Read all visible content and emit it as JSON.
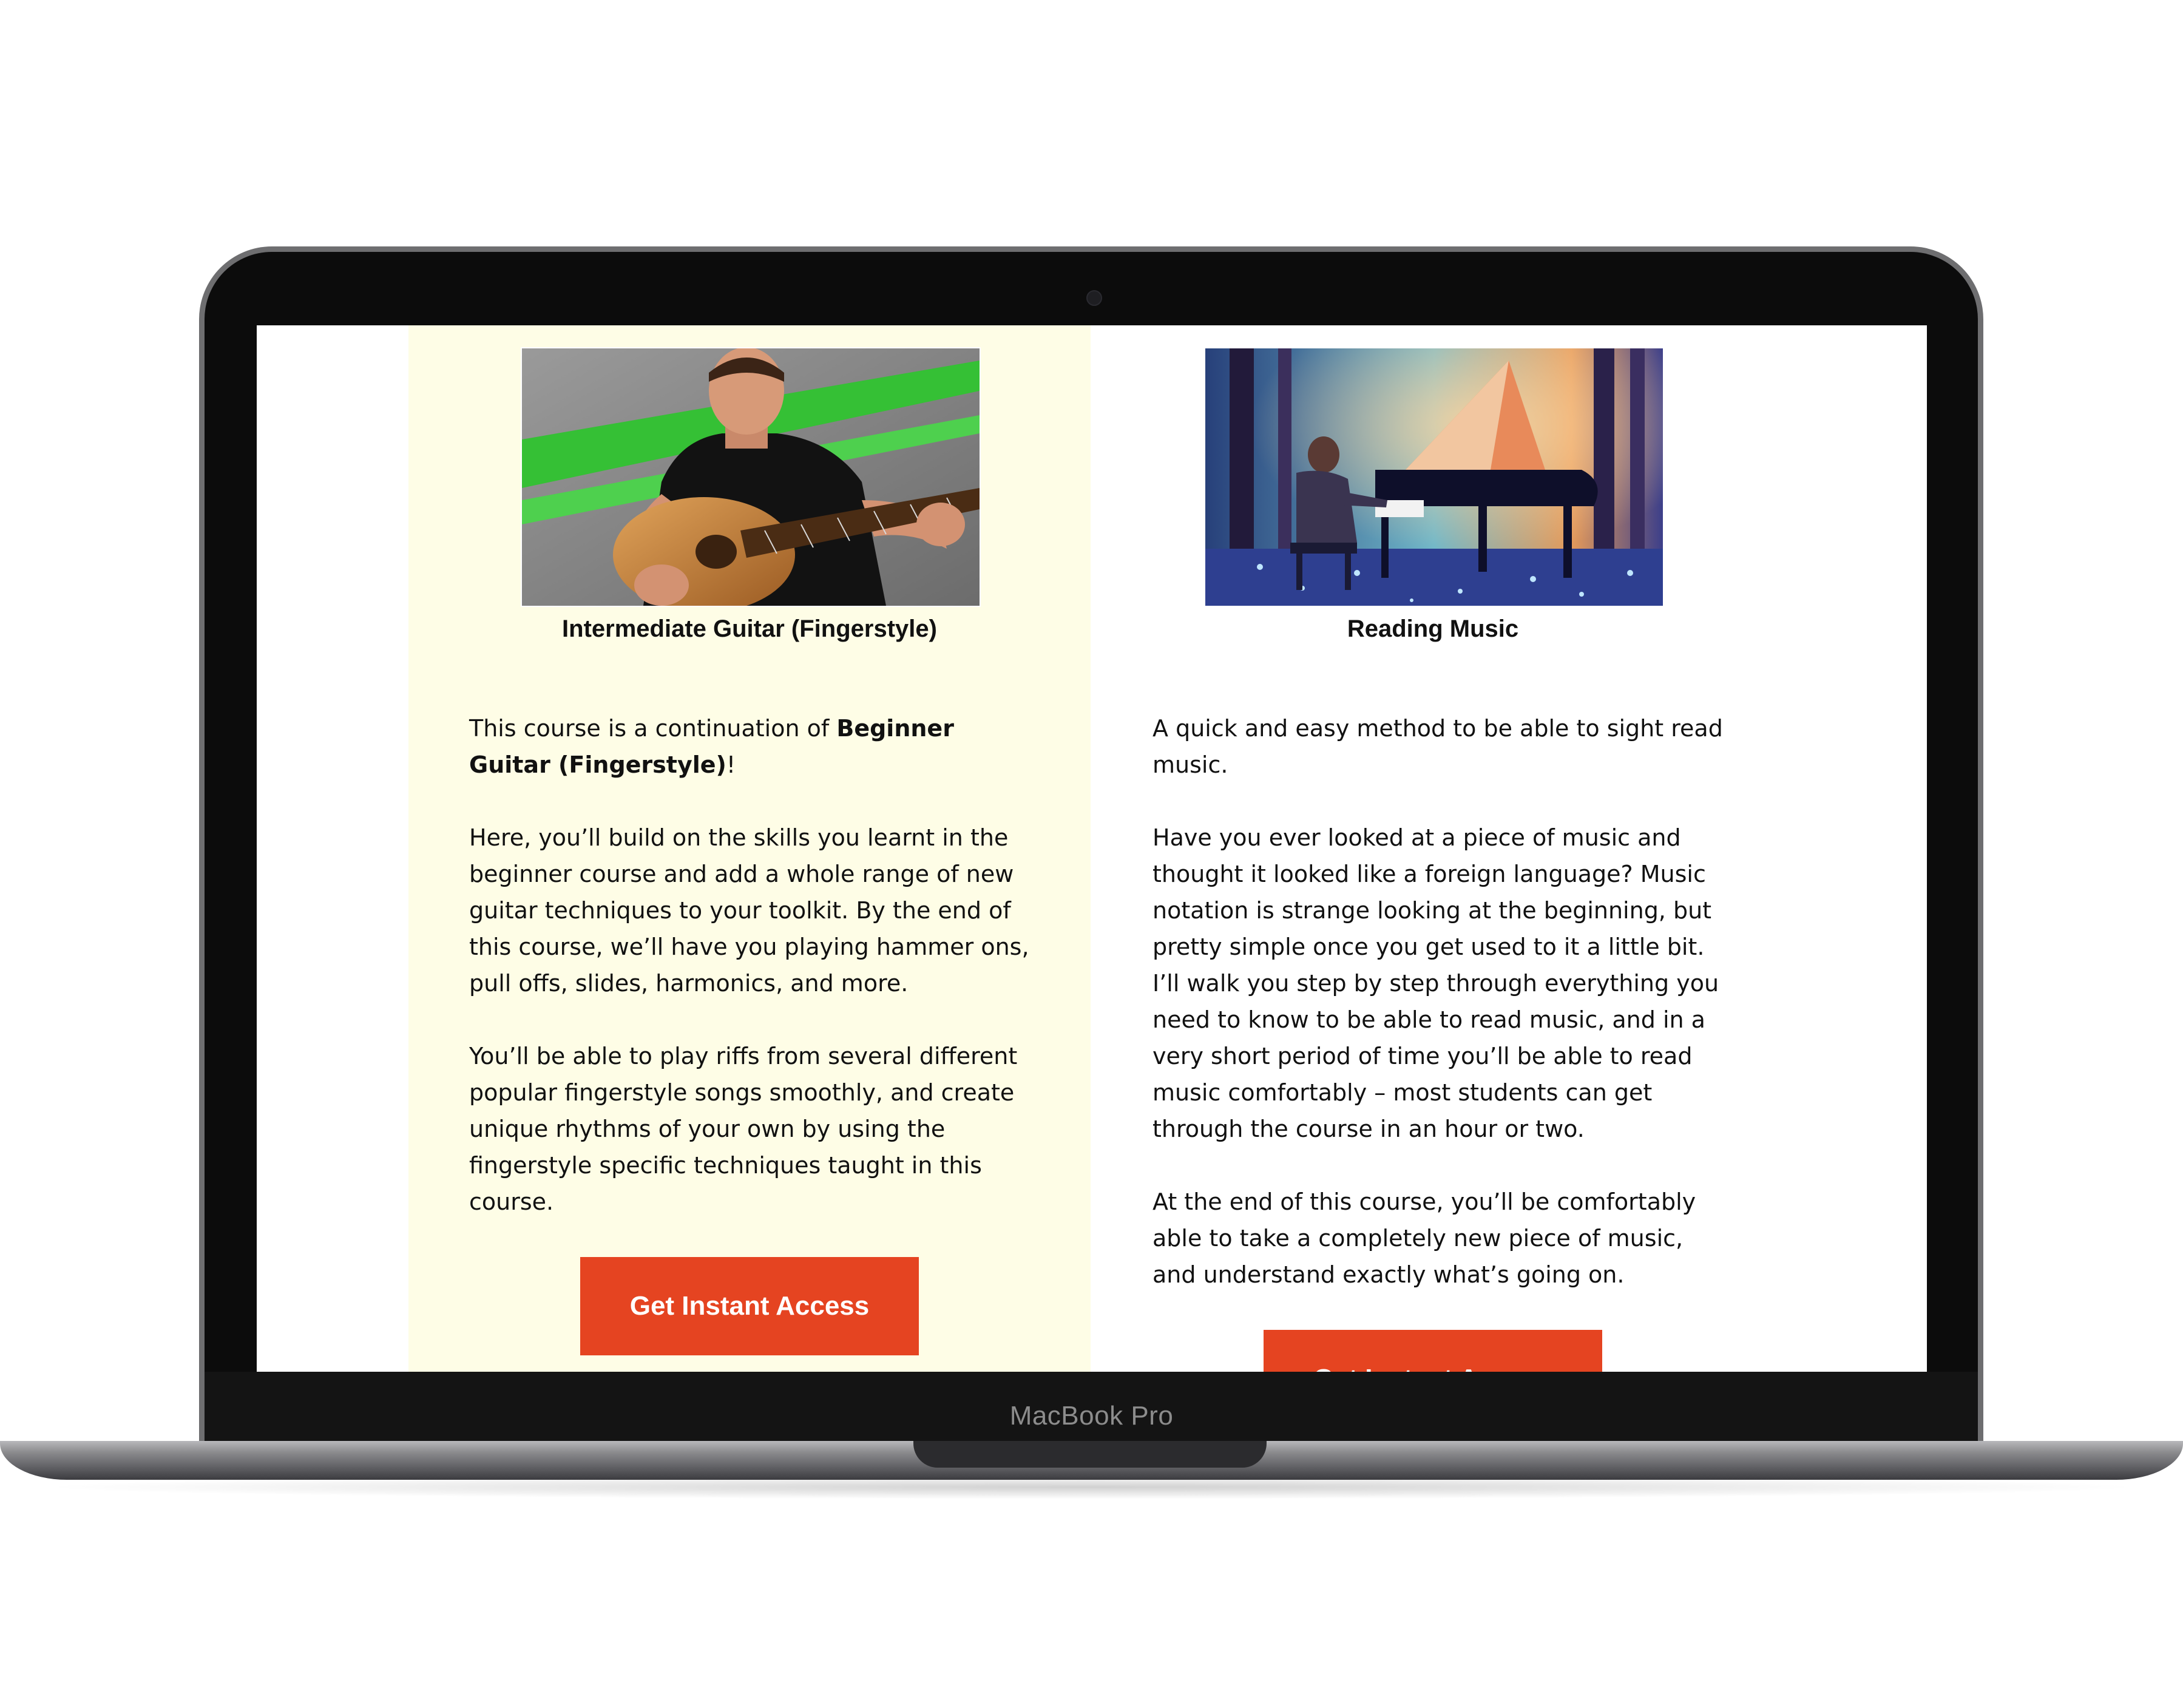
{
  "device": {
    "brand_label": "MacBook Pro"
  },
  "courses": [
    {
      "title": "Intermediate Guitar (Fingerstyle)",
      "image_icon": "guitarist-photo",
      "desc_intro": "This course is a continuation of ",
      "desc_intro_bold": "Beginner Guitar (Fingerstyle)",
      "desc_intro_end": "!",
      "paragraphs": [
        "Here, you’ll build on the skills you learnt in the beginner course and add a whole range of new guitar techniques to your toolkit. By the end of this course, we’ll have you playing hammer ons, pull offs, slides, harmonics, and more.",
        "You’ll be able to play riffs from several different popular fingerstyle songs smoothly, and create unique rhythms of your own by using the fingerstyle specific techniques taught in this course."
      ],
      "cta_label": "Get Instant Access",
      "background": "#fefde6"
    },
    {
      "title": "Reading Music",
      "image_icon": "pianist-forest-painting",
      "paragraphs": [
        "A quick and easy method to be able to sight read music.",
        "Have you ever looked at a piece of music and thought it looked like a foreign language? Music notation is strange looking at the beginning, but pretty simple once you get used to it a little bit. I’ll walk you step by step through everything you need to know to be able to read music, and in a very short period of time you’ll be able to read music comfortably – most students can get through the course in an hour or two.",
        "At the end of this course, you’ll be comfortably able to take a completely new piece of music, and understand exactly what’s going on."
      ],
      "cta_label": "Get Instant Access",
      "background": "#ffffff"
    }
  ],
  "colors": {
    "cta": "#e54421",
    "text": "#111111"
  }
}
